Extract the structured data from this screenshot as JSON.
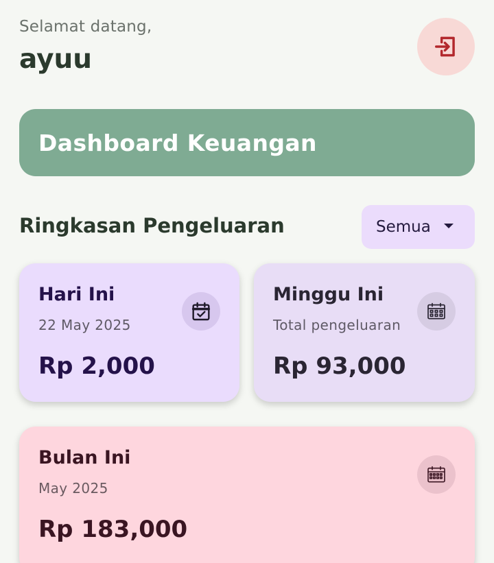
{
  "header": {
    "greeting": "Selamat datang,",
    "username": "ayuu",
    "logout_icon": "logout-icon"
  },
  "banner": {
    "title": "Dashboard Keuangan"
  },
  "summary": {
    "title": "Ringkasan Pengeluaran",
    "filter": {
      "selected": "Semua"
    }
  },
  "cards": {
    "today": {
      "title": "Hari Ini",
      "subtitle": "22 May 2025",
      "amount": "Rp 2,000",
      "icon": "calendar-check-icon"
    },
    "week": {
      "title": "Minggu Ini",
      "subtitle": "Total pengeluaran",
      "amount": "Rp 93,000",
      "icon": "calendar-week-icon"
    },
    "month": {
      "title": "Bulan Ini",
      "subtitle": "May 2025",
      "amount": "Rp 183,000",
      "icon": "calendar-month-icon"
    }
  },
  "colors": {
    "background": "#f5f7f3",
    "banner": "#7fab93",
    "logout_bg": "#f8d9d6",
    "logout_icon": "#b3282d",
    "today_card": "#eadcfd",
    "week_card": "#e8ddf6",
    "month_card": "#fed6de",
    "filter_bg": "#ebdcfc"
  }
}
